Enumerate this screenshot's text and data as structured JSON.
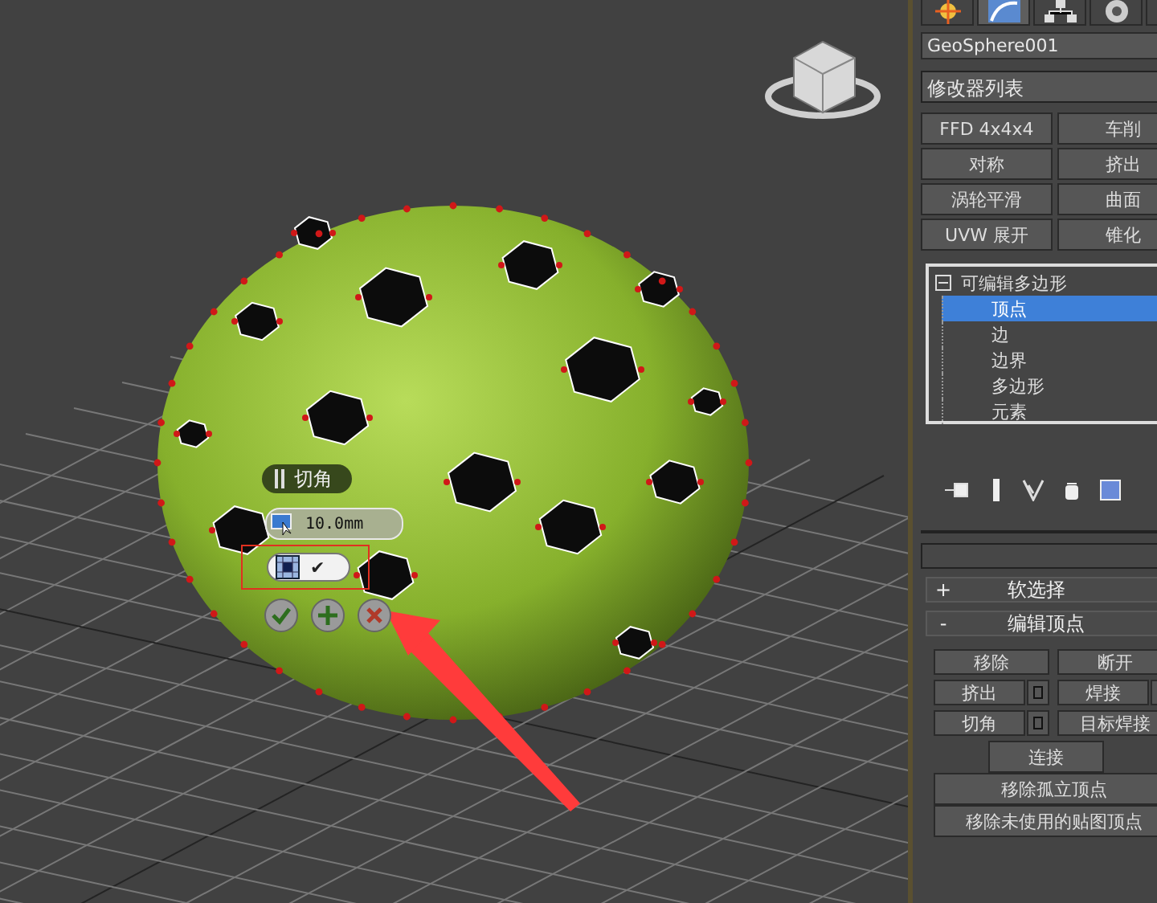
{
  "viewport": {
    "caddy": {
      "title": "切角",
      "value": "10.0mm",
      "mode_check": "✔"
    }
  },
  "command_panel": {
    "tabs": [
      {
        "kind": "create",
        "selected": false
      },
      {
        "kind": "modify",
        "selected": true
      },
      {
        "kind": "hierarchy",
        "selected": false
      },
      {
        "kind": "motion",
        "selected": false
      },
      {
        "kind": "display",
        "selected": false
      }
    ],
    "object_name": "GeoSphere001",
    "modifier_list": "修改器列表",
    "modifier_buttons": [
      "FFD 4x4x4",
      "车削",
      "对称",
      "挤出",
      "涡轮平滑",
      "曲面",
      "UVW 展开",
      "锥化"
    ],
    "stack": {
      "label": "可编辑多边形",
      "expanded": true,
      "children": [
        {
          "label": "顶点",
          "selected": true
        },
        {
          "label": "边",
          "selected": false
        },
        {
          "label": "边界",
          "selected": false
        },
        {
          "label": "多边形",
          "selected": false
        },
        {
          "label": "元素",
          "selected": false
        }
      ]
    },
    "rollouts": [
      {
        "sign": "+",
        "title": "软选择"
      },
      {
        "sign": "-",
        "title": "编辑顶点"
      }
    ],
    "edit_rows": [
      {
        "kind": "pair",
        "buttons": [
          {
            "label": "移除",
            "settings": false
          },
          {
            "label": "断开",
            "settings": false
          }
        ]
      },
      {
        "kind": "pair",
        "buttons": [
          {
            "label": "挤出",
            "settings": true
          },
          {
            "label": "焊接",
            "settings": true
          }
        ]
      },
      {
        "kind": "pair",
        "buttons": [
          {
            "label": "切角",
            "settings": true
          },
          {
            "label": "目标焊接",
            "settings": false
          }
        ]
      },
      {
        "kind": "narrow",
        "buttons": [
          {
            "label": "连接",
            "settings": false
          }
        ]
      },
      {
        "kind": "wide",
        "buttons": [
          {
            "label": "移除孤立顶点",
            "settings": false
          }
        ]
      },
      {
        "kind": "wide",
        "buttons": [
          {
            "label": "移除未使用的贴图顶点",
            "settings": false
          }
        ]
      }
    ]
  }
}
